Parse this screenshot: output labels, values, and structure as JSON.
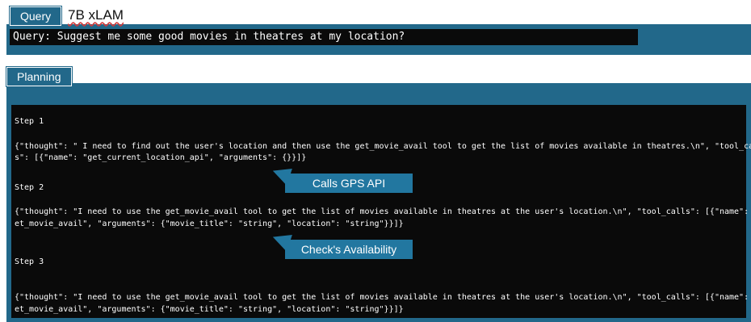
{
  "query_section": {
    "tab_label": "Query",
    "model_label": "7B xLAM",
    "query_text": "Query: Suggest me some good movies in theatres at my location?"
  },
  "planning_section": {
    "tab_label": "Planning",
    "steps": [
      {
        "label": "Step 1",
        "lines": [
          "{\"thought\": \" I need to find out the user's location and then use the get_movie_avail tool to get the list of movies available in theatres.\\n\", \"tool_call",
          "s\": [{\"name\": \"get_current_location_api\", \"arguments\": {}}]}"
        ]
      },
      {
        "label": "Step 2",
        "lines": [
          "{\"thought\": \"I need to use the get_movie_avail tool to get the list of movies available in theatres at the user's location.\\n\", \"tool_calls\": [{\"name\": \"g",
          "et_movie_avail\", \"arguments\": {\"movie_title\": \"string\", \"location\": \"string\"}}]}"
        ]
      },
      {
        "label": "Step 3",
        "lines": [
          "{\"thought\": \"I need to use the get_movie_avail tool to get the list of movies available in theatres at the user's location.\\n\", \"tool_calls\": [{\"name\": \"g",
          "et_movie_avail\", \"arguments\": {\"movie_title\": \"string\", \"location\": \"string\"}}]}"
        ]
      }
    ]
  },
  "callouts": [
    {
      "label": "Calls GPS API"
    },
    {
      "label": "Check's Availability"
    }
  ],
  "colors": {
    "accent_blue": "#22688a",
    "callout_blue": "#2277a0",
    "terminal_bg": "#0a0a0a"
  }
}
